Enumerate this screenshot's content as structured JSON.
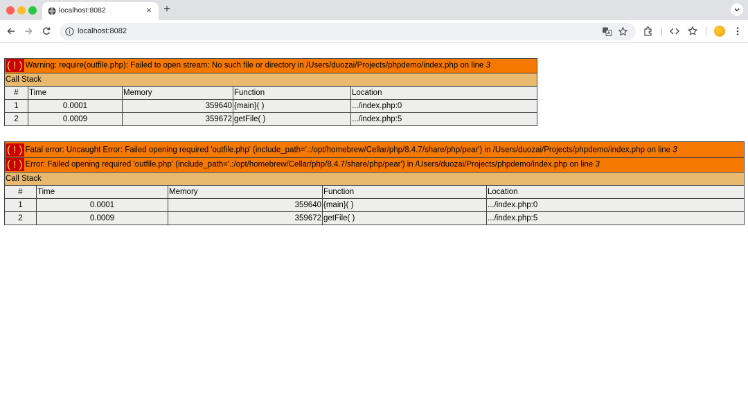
{
  "browser": {
    "tab_title": "localhost:8082",
    "tab_close": "×",
    "new_tab": "+",
    "url": "localhost:8082",
    "icons": [
      "back-icon",
      "forward-icon",
      "reload-icon",
      "site-info-icon",
      "translate-icon",
      "bookmark-star-icon",
      "extensions-icon",
      "devtools-icon",
      "bookmarks-icon",
      "profile-avatar",
      "menu-icon"
    ]
  },
  "bang": "( ! )",
  "warning": {
    "message": "Warning: require(outfile.php): Failed to open stream: No such file or directory in /Users/duozai/Projects/phpdemo/index.php on line ",
    "line": "3",
    "call_stack_label": "Call Stack",
    "headers": {
      "num": "#",
      "time": "Time",
      "memory": "Memory",
      "function": "Function",
      "location": "Location"
    },
    "rows": [
      {
        "num": "1",
        "time": "0.0001",
        "memory": "359640",
        "function": "{main}( )",
        "location": ".../index.php:0"
      },
      {
        "num": "2",
        "time": "0.0009",
        "memory": "359672",
        "function": "getFile( )",
        "location": ".../index.php:5"
      }
    ]
  },
  "fatal": {
    "message": "Fatal error: Uncaught Error: Failed opening required 'outfile.php' (include_path='.:/opt/homebrew/Cellar/php/8.4.7/share/php/pear') in /Users/duozai/Projects/phpdemo/index.php on line ",
    "line": "3",
    "error_message": "Error: Failed opening required 'outfile.php' (include_path='.:/opt/homebrew/Cellar/php/8.4.7/share/php/pear') in /Users/duozai/Projects/phpdemo/index.php on line ",
    "error_line": "3",
    "call_stack_label": "Call Stack",
    "headers": {
      "num": "#",
      "time": "Time",
      "memory": "Memory",
      "function": "Function",
      "location": "Location"
    },
    "rows": [
      {
        "num": "1",
        "time": "0.0001",
        "memory": "359640",
        "function": "{main}( )",
        "location": ".../index.php:0"
      },
      {
        "num": "2",
        "time": "0.0009",
        "memory": "359672",
        "function": "getFile( )",
        "location": ".../index.php:5"
      }
    ]
  },
  "colors": {
    "error_bg": "#f57900",
    "call_stack_bg": "#e9b96e",
    "row_bg": "#eeeeec",
    "bang_bg": "#cc0000",
    "bang_fg": "#fce94f"
  }
}
